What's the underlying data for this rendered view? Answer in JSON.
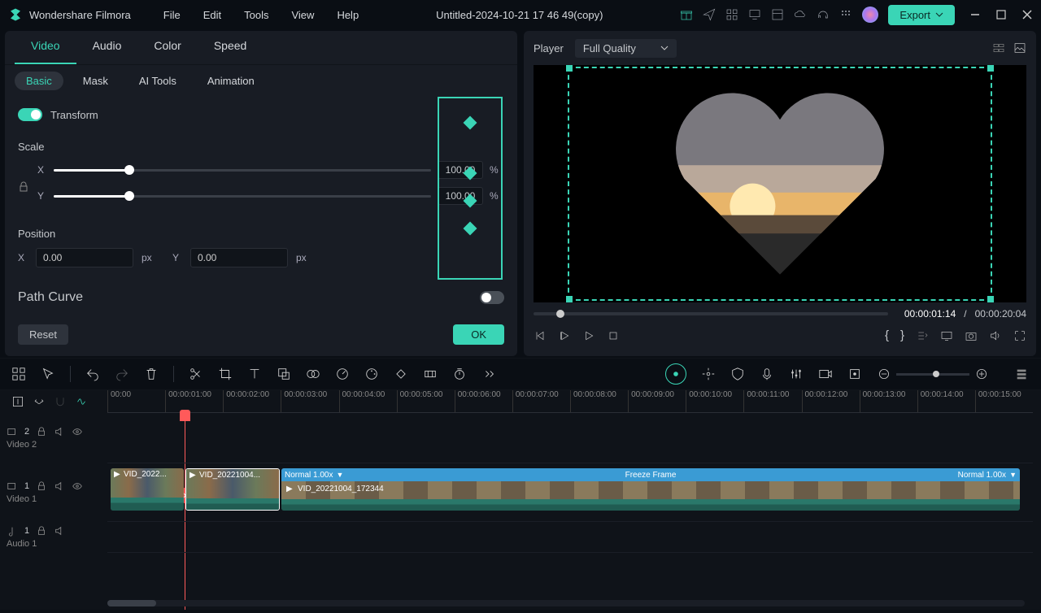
{
  "app": {
    "name": "Wondershare Filmora"
  },
  "menu": {
    "file": "File",
    "edit": "Edit",
    "tools": "Tools",
    "view": "View",
    "help": "Help"
  },
  "document": {
    "title": "Untitled-2024-10-21 17 46 49(copy)"
  },
  "export_label": "Export",
  "edit_tabs": {
    "video": "Video",
    "audio": "Audio",
    "color": "Color",
    "speed": "Speed"
  },
  "sub_tabs": {
    "basic": "Basic",
    "mask": "Mask",
    "ai": "AI Tools",
    "anim": "Animation"
  },
  "transform": {
    "label": "Transform",
    "scale_label": "Scale",
    "x_label": "X",
    "y_label": "Y",
    "scale_x": "100.00",
    "scale_y": "100.00",
    "percent": "%",
    "position_label": "Position",
    "pos_x": "0.00",
    "pos_y": "0.00",
    "px": "px",
    "path_curve": "Path Curve",
    "reset": "Reset",
    "ok": "OK"
  },
  "player": {
    "label": "Player",
    "quality": "Full Quality",
    "current": "00:00:01:14",
    "sep": "/",
    "total": "00:00:20:04"
  },
  "tracks": {
    "track2_badge": "2",
    "track2_label": "Video 2",
    "track1_badge": "1",
    "track1_label": "Video 1",
    "audio1_badge": "1",
    "audio1_label": "Audio 1"
  },
  "clips": {
    "c1": "VID_2022...",
    "c2": "VID_20221004...",
    "bar_normal": "Normal 1.00x",
    "bar_freeze": "Freeze Frame",
    "c3": "VID_20221004_172344"
  },
  "ruler": [
    "00:00",
    "00:00:01:00",
    "00:00:02:00",
    "00:00:03:00",
    "00:00:04:00",
    "00:00:05:00",
    "00:00:06:00",
    "00:00:07:00",
    "00:00:08:00",
    "00:00:09:00",
    "00:00:10:00",
    "00:00:11:00",
    "00:00:12:00",
    "00:00:13:00",
    "00:00:14:00",
    "00:00:15:00"
  ]
}
